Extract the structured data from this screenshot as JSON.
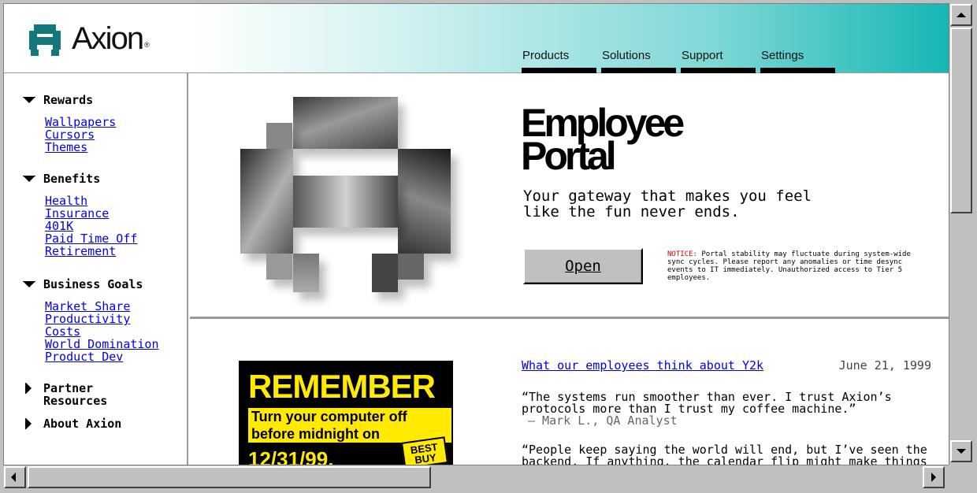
{
  "header": {
    "brand": "Axion",
    "registered_mark": "®",
    "nav": [
      {
        "label": "Products"
      },
      {
        "label": "Solutions"
      },
      {
        "label": "Support"
      },
      {
        "label": "Settings"
      }
    ]
  },
  "sidebar": {
    "sections": [
      {
        "title": "Rewards",
        "expanded": true,
        "links": [
          "Wallpapers",
          "Cursors",
          "Themes"
        ]
      },
      {
        "title": "Benefits",
        "expanded": true,
        "links": [
          "Health",
          "Insurance",
          "401K",
          "Paid Time Off",
          "Retirement"
        ]
      },
      {
        "title": "Business Goals",
        "expanded": true,
        "links": [
          "Market Share",
          "Productivity",
          "Costs",
          "World Domination",
          "Product Dev"
        ]
      },
      {
        "title": "Partner Resources",
        "title_lines": [
          "Partner",
          "Resources"
        ],
        "expanded": false
      },
      {
        "title": "About Axion",
        "expanded": false
      }
    ]
  },
  "hero": {
    "title_line1": "Employee",
    "title_line2": "Portal",
    "tagline": "Your gateway that makes you feel like the fun never ends.",
    "open_button": "Open",
    "notice_label": "NOTICE:",
    "notice_text": " Portal stability may fluctuate during system-wide sync cycles. Please report any anomalies or time desync events to IT immediately. Unauthorized access to Tier 5 employees."
  },
  "ad": {
    "line1": "REMEMBER",
    "line2": "Turn your computer off before midnight on",
    "line3": "12/31/99.",
    "store_logo": "BEST BUY"
  },
  "article": {
    "link": "What our employees think about Y2k",
    "date": "June 21, 1999",
    "quotes": [
      {
        "text": "“The systems run smoother than ever. I trust Axion’s protocols more than I trust my coffee machine.”",
        "attribution": "– Mark L., QA Analyst"
      },
      {
        "text": "“People keep saying the world will end, but I’ve seen the backend. If anything, the calendar flip might make things faster.”"
      }
    ]
  },
  "colors": {
    "link": "#0000ee",
    "teal": "#15b6b4",
    "notice_red": "#e00000",
    "ad_yellow": "#ffea00"
  }
}
